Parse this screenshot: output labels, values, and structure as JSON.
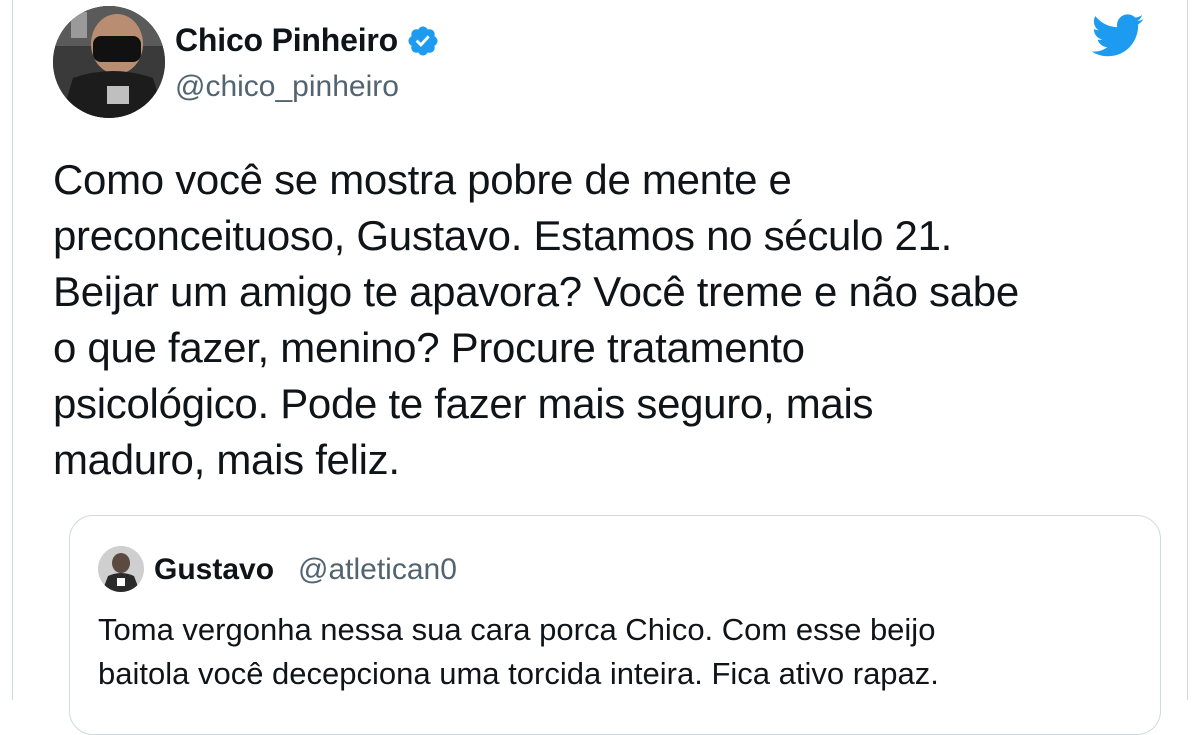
{
  "tweet": {
    "display_name": "Chico Pinheiro",
    "handle": "@chico_pinheiro",
    "verified_icon": "verified-badge-icon",
    "logo_icon": "twitter-bird-icon",
    "brand_color": "#1d9bf0",
    "text_lines": [
      "Como você se mostra pobre de mente e",
      "preconceituoso, Gustavo. Estamos no século 21.",
      "Beijar um amigo te apavora? Você treme e não sabe",
      "o que fazer, menino? Procure tratamento",
      "psicológico. Pode te fazer mais seguro, mais",
      "maduro, mais feliz."
    ]
  },
  "quoted_tweet": {
    "display_name": "Gustavo",
    "handle": "@atletican0",
    "text_lines": [
      "Toma vergonha nessa sua cara porca Chico. Com esse beijo",
      "baitola você decepciona uma torcida inteira. Fica ativo rapaz."
    ]
  }
}
